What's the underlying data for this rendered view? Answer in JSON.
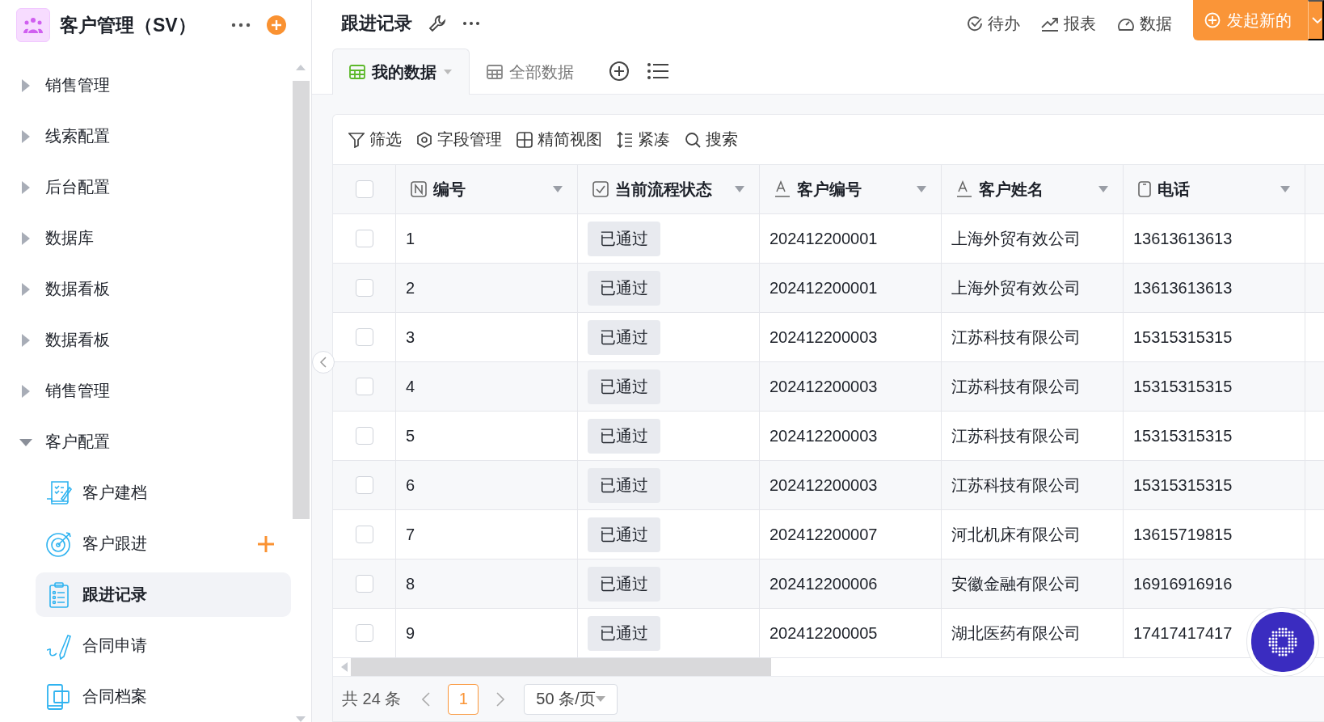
{
  "app": {
    "title": "客户管理（SV）"
  },
  "sidebar": {
    "items": [
      {
        "label": "销售管理",
        "expanded": false
      },
      {
        "label": "线索配置",
        "expanded": false
      },
      {
        "label": "后台配置",
        "expanded": false
      },
      {
        "label": "数据库",
        "expanded": false
      },
      {
        "label": "数据看板",
        "expanded": false
      },
      {
        "label": "数据看板",
        "expanded": false
      },
      {
        "label": "销售管理",
        "expanded": false
      },
      {
        "label": "客户配置",
        "expanded": true,
        "children": [
          {
            "label": "客户建档",
            "selected": false,
            "add_button": false
          },
          {
            "label": "客户跟进",
            "selected": false,
            "add_button": true
          },
          {
            "label": "跟进记录",
            "selected": true,
            "add_button": false
          },
          {
            "label": "合同申请",
            "selected": false,
            "add_button": false
          },
          {
            "label": "合同档案",
            "selected": false,
            "add_button": false
          }
        ]
      }
    ]
  },
  "page": {
    "title": "跟进记录",
    "actions": [
      "待办",
      "报表",
      "数据"
    ],
    "primary_button": "发起新的"
  },
  "tabs": [
    {
      "label": "我的数据",
      "selected": true
    },
    {
      "label": "全部数据",
      "selected": false
    }
  ],
  "toolbar": [
    "筛选",
    "字段管理",
    "精简视图",
    "紧凑",
    "搜索"
  ],
  "table": {
    "all_checked": false,
    "columns": [
      {
        "label": "编号",
        "kind": "number"
      },
      {
        "label": "当前流程状态",
        "kind": "status"
      },
      {
        "label": "客户编号",
        "kind": "text"
      },
      {
        "label": "客户姓名",
        "kind": "text"
      },
      {
        "label": "电话",
        "kind": "phone"
      }
    ],
    "rows": [
      {
        "checked": false,
        "cells": [
          "1",
          "已通过",
          "202412200001",
          "上海外贸有效公司",
          "13613613613"
        ]
      },
      {
        "checked": false,
        "cells": [
          "2",
          "已通过",
          "202412200001",
          "上海外贸有效公司",
          "13613613613"
        ]
      },
      {
        "checked": false,
        "cells": [
          "3",
          "已通过",
          "202412200003",
          "江苏科技有限公司",
          "15315315315"
        ]
      },
      {
        "checked": false,
        "cells": [
          "4",
          "已通过",
          "202412200003",
          "江苏科技有限公司",
          "15315315315"
        ]
      },
      {
        "checked": false,
        "cells": [
          "5",
          "已通过",
          "202412200003",
          "江苏科技有限公司",
          "15315315315"
        ]
      },
      {
        "checked": false,
        "cells": [
          "6",
          "已通过",
          "202412200003",
          "江苏科技有限公司",
          "15315315315"
        ]
      },
      {
        "checked": false,
        "cells": [
          "7",
          "已通过",
          "202412200007",
          "河北机床有限公司",
          "13615719815"
        ]
      },
      {
        "checked": false,
        "cells": [
          "8",
          "已通过",
          "202412200006",
          "安徽金融有限公司",
          "16916916916"
        ]
      },
      {
        "checked": false,
        "cells": [
          "9",
          "已通过",
          "202412200005",
          "湖北医药有限公司",
          "17417417417"
        ]
      }
    ]
  },
  "pagination": {
    "total": "共 24 条",
    "page": "1",
    "page_size": "50 条/页"
  }
}
